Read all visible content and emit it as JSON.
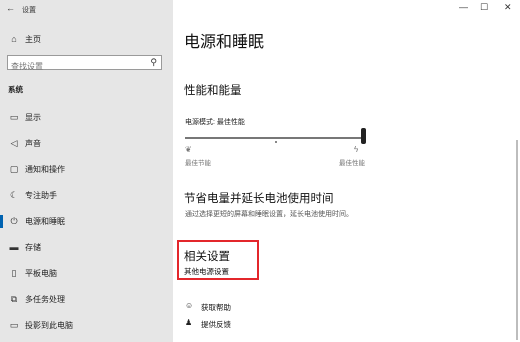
{
  "window": {
    "back_icon": "back-arrow-icon",
    "title": "设置",
    "controls": [
      "minimize-icon",
      "maximize-icon",
      "close-icon"
    ]
  },
  "sidebar": {
    "home_label": "主页",
    "search_placeholder": "查找设置",
    "section_label": "系统",
    "items": [
      {
        "label": "显示",
        "icon": "display-icon"
      },
      {
        "label": "声音",
        "icon": "sound-icon"
      },
      {
        "label": "通知和操作",
        "icon": "notification-icon"
      },
      {
        "label": "专注助手",
        "icon": "focus-assist-icon"
      },
      {
        "label": "电源和睡眠",
        "icon": "power-icon",
        "active": true
      },
      {
        "label": "存储",
        "icon": "storage-icon"
      },
      {
        "label": "平板电脑",
        "icon": "tablet-icon"
      },
      {
        "label": "多任务处理",
        "icon": "multitasking-icon"
      },
      {
        "label": "投影到此电脑",
        "icon": "project-icon"
      }
    ]
  },
  "main": {
    "title": "电源和睡眠",
    "performance": {
      "heading": "性能和能量",
      "mode_label": "电源模式: 最佳性能",
      "left_label": "最佳节能",
      "right_label": "最佳性能",
      "slider_value_fraction": 1.0
    },
    "battery": {
      "heading": "节省电量并延长电池使用时间",
      "description": "通过选择更短的屏幕和睡眠设置，延长电池使用时间。"
    },
    "related": {
      "heading": "相关设置",
      "link": "其他电源设置"
    },
    "help": {
      "get_help": "获取帮助",
      "feedback": "提供反馈"
    }
  }
}
